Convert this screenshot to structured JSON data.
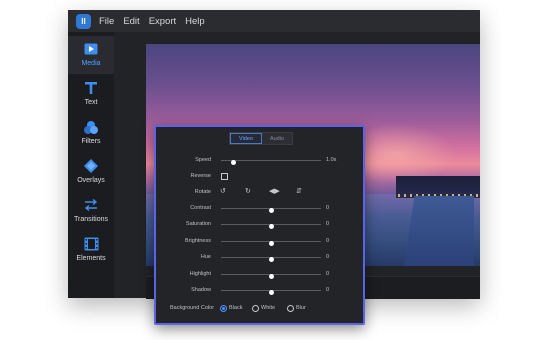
{
  "menu": {
    "logo": "ll",
    "items": [
      "File",
      "Edit",
      "Export",
      "Help"
    ]
  },
  "sidebar": {
    "items": [
      {
        "label": "Media",
        "icon": "play-box-icon",
        "active": true
      },
      {
        "label": "Text",
        "icon": "text-t-icon",
        "active": false
      },
      {
        "label": "Filters",
        "icon": "filters-circles-icon",
        "active": false
      },
      {
        "label": "Overlays",
        "icon": "overlay-diamond-icon",
        "active": false
      },
      {
        "label": "Transitions",
        "icon": "transition-arrows-icon",
        "active": false
      },
      {
        "label": "Elements",
        "icon": "film-strip-icon",
        "active": false
      }
    ]
  },
  "panel": {
    "tabs": [
      {
        "label": "Video",
        "active": true
      },
      {
        "label": "Audio",
        "active": false
      }
    ],
    "speed": {
      "label": "Speed",
      "value": "1.0x",
      "level": 0.12
    },
    "reverse": {
      "label": "Reverse",
      "checked": false
    },
    "rotate": {
      "label": "Rotate",
      "icons": [
        "rotate-left-icon",
        "rotate-right-icon",
        "flip-horizontal-icon",
        "flip-vertical-icon"
      ]
    },
    "sliders": [
      {
        "label": "Contrast",
        "value": "0",
        "level": 0.5
      },
      {
        "label": "Saturation",
        "value": "0",
        "level": 0.5
      },
      {
        "label": "Brightness",
        "value": "0",
        "level": 0.5
      },
      {
        "label": "Hue",
        "value": "0",
        "level": 0.5
      },
      {
        "label": "Highlight",
        "value": "0",
        "level": 0.5
      },
      {
        "label": "Shadow",
        "value": "0",
        "level": 0.5
      }
    ],
    "background_color": {
      "label": "Background Color",
      "options": [
        "Black",
        "White",
        "Blur"
      ],
      "selected": "Black"
    }
  },
  "colors": {
    "accent": "#4f8dff",
    "panel_border": "#5b63e6",
    "active_sidebar_label": "#4fa3ff"
  }
}
